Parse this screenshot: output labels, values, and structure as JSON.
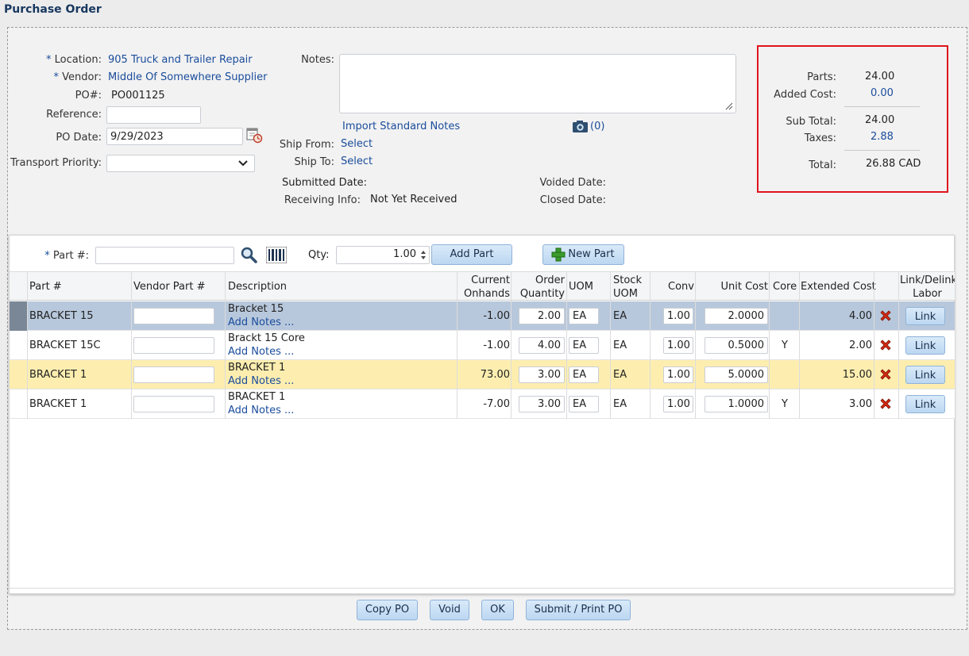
{
  "page_title": "Purchase Order",
  "header": {
    "location_label": "Location:",
    "location_value": "905 Truck and Trailer Repair",
    "vendor_label": "Vendor:",
    "vendor_value": "Middle Of Somewhere Supplier",
    "po_label": "PO#:",
    "po_value": "PO001125",
    "reference_label": "Reference:",
    "reference_value": "",
    "po_date_label": "PO Date:",
    "po_date_value": "9/29/2023",
    "transport_label": "Transport Priority:",
    "transport_value": "",
    "required_mark": "*"
  },
  "notes": {
    "label": "Notes:",
    "value": "",
    "import_link": "Import Standard Notes",
    "attachments_count": "(0)"
  },
  "shipping": {
    "from_label": "Ship From:",
    "from_value": "Select",
    "to_label": "Ship To:",
    "to_value": "Select",
    "submitted_label": "Submitted Date:",
    "submitted_value": "",
    "receiving_label": "Receiving Info:",
    "receiving_value": "Not Yet Received",
    "voided_label": "Voided Date:",
    "voided_value": "",
    "closed_label": "Closed Date:",
    "closed_value": ""
  },
  "totals": {
    "parts_label": "Parts:",
    "parts_value": "24.00",
    "added_label": "Added Cost:",
    "added_value": "0.00",
    "subtotal_label": "Sub Total:",
    "subtotal_value": "24.00",
    "taxes_label": "Taxes:",
    "taxes_value": "2.88",
    "total_label": "Total:",
    "total_value": "26.88",
    "currency": "CAD"
  },
  "add_part": {
    "part_label": "Part #:",
    "part_value": "",
    "qty_label": "Qty:",
    "qty_value": "1.00",
    "add_button": "Add Part",
    "new_button": "New Part"
  },
  "columns": {
    "part": "Part #",
    "vendor_part": "Vendor Part #",
    "description": "Description",
    "current_onhands_1": "Current",
    "current_onhands_2": "Onhands",
    "order_qty_1": "Order",
    "order_qty_2": "Quantity",
    "uom": "UOM",
    "stock_uom_1": "Stock",
    "stock_uom_2": "UOM",
    "conv": "Conv",
    "unit_cost": "Unit Cost",
    "core": "Core",
    "extended_cost": "Extended Cost",
    "link_1": "Link/Delink",
    "link_2": "Labor"
  },
  "rows": [
    {
      "part": "BRACKET 15",
      "vendor_part": "",
      "description": "Bracket 15",
      "add_notes": "Add Notes ...",
      "onhands": "-1.00",
      "order_qty": "2.00",
      "uom": "EA",
      "stock_uom": "EA",
      "conv": "1.00",
      "unit_cost": "2.0000",
      "core": "",
      "extended": "4.00",
      "link": "Link"
    },
    {
      "part": "BRACKET 15C",
      "vendor_part": "",
      "description": "Brackt 15 Core",
      "add_notes": "Add Notes ...",
      "onhands": "-1.00",
      "order_qty": "4.00",
      "uom": "EA",
      "stock_uom": "EA",
      "conv": "1.00",
      "unit_cost": "0.5000",
      "core": "Y",
      "extended": "2.00",
      "link": "Link"
    },
    {
      "part": "BRACKET 1",
      "vendor_part": "",
      "description": "BRACKET 1",
      "add_notes": "Add Notes ...",
      "onhands": "73.00",
      "order_qty": "3.00",
      "uom": "EA",
      "stock_uom": "EA",
      "conv": "1.00",
      "unit_cost": "5.0000",
      "core": "",
      "extended": "15.00",
      "link": "Link"
    },
    {
      "part": "BRACKET 1",
      "vendor_part": "",
      "description": "BRACKET 1",
      "add_notes": "Add Notes ...",
      "onhands": "-7.00",
      "order_qty": "3.00",
      "uom": "EA",
      "stock_uom": "EA",
      "conv": "1.00",
      "unit_cost": "1.0000",
      "core": "Y",
      "extended": "3.00",
      "link": "Link"
    }
  ],
  "row_colors": [
    "#b8c8dc",
    "#ffffff",
    "#fdeeb0",
    "#ffffff"
  ],
  "actions": {
    "copy": "Copy PO",
    "void": "Void",
    "ok": "OK",
    "submit": "Submit / Print PO"
  },
  "colors": {
    "accent": "#1a4c9c",
    "highlight_border": "#e0141e",
    "delete": "#d42a10"
  }
}
